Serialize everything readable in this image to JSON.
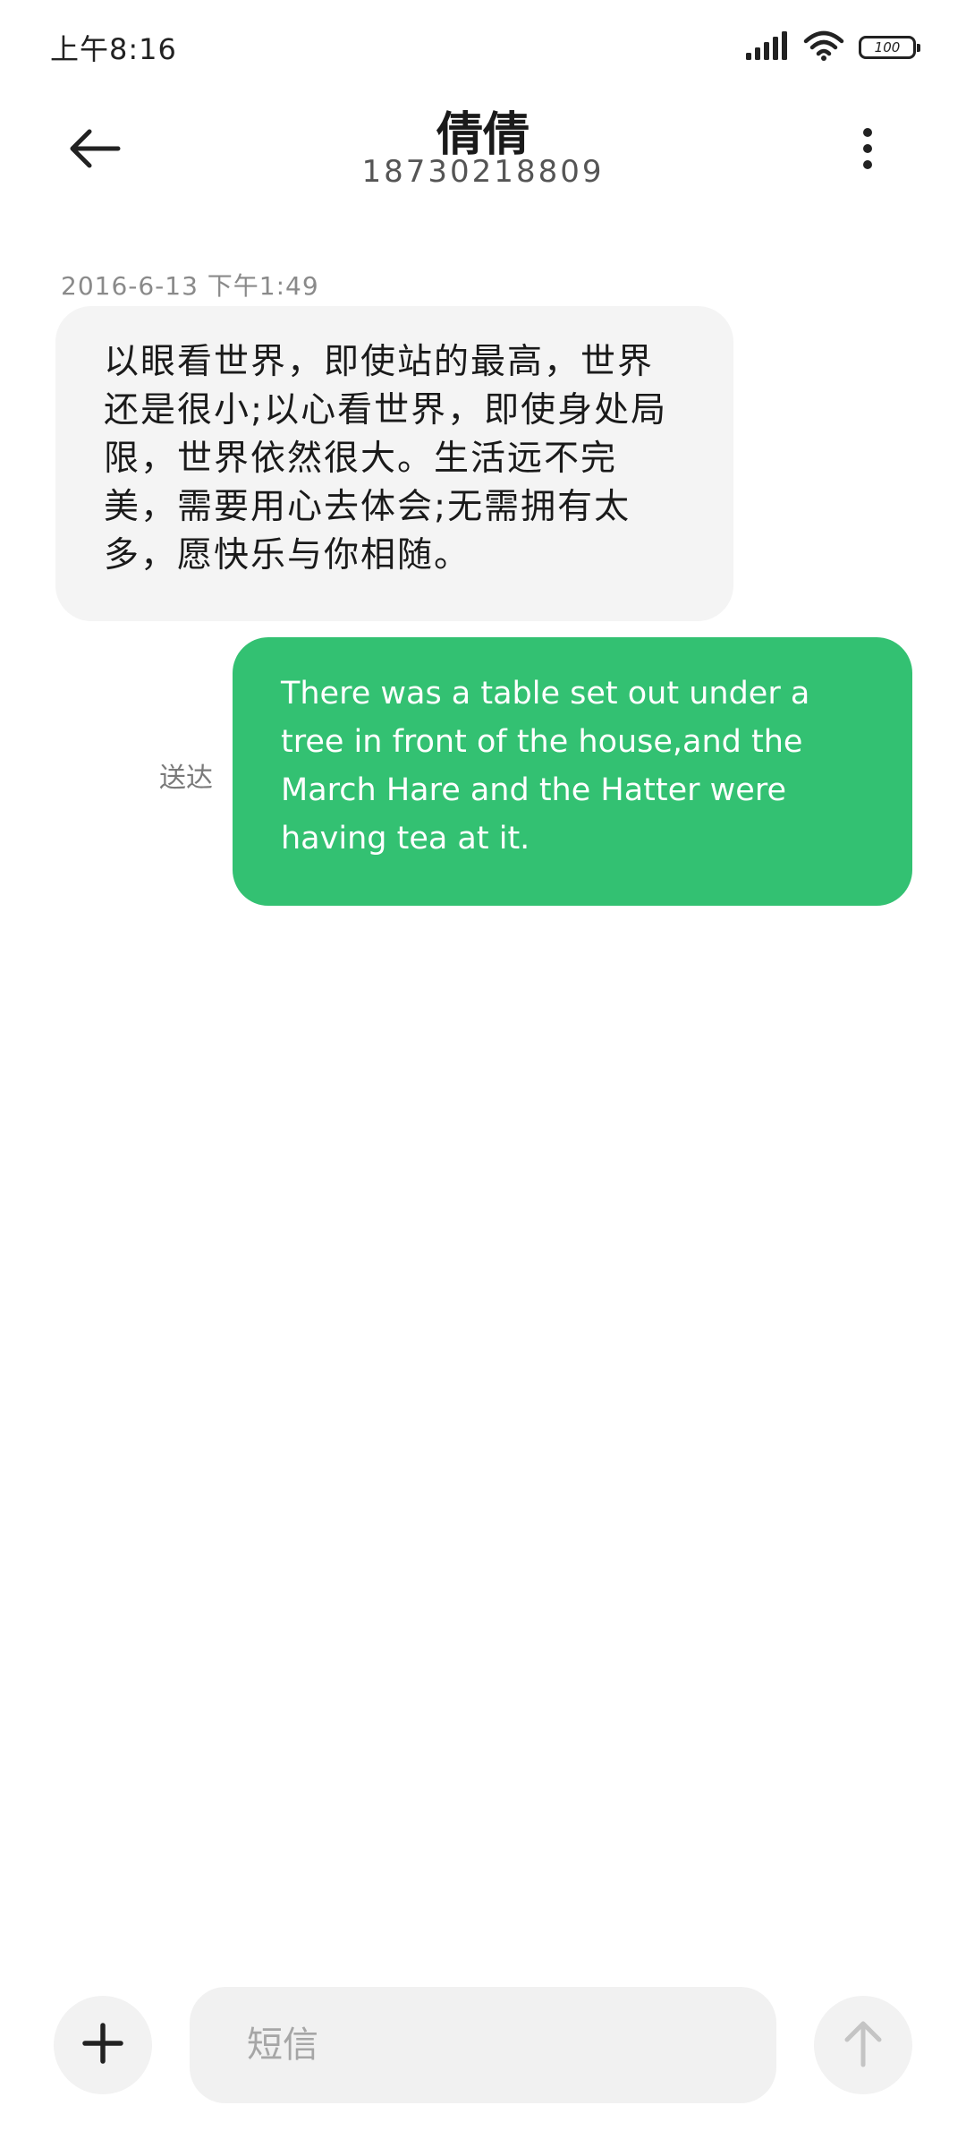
{
  "status_bar": {
    "time": "上午8:16",
    "battery_level": "100",
    "icons": [
      "signal-icon",
      "wifi-icon",
      "battery-icon"
    ]
  },
  "header": {
    "contact_name": "倩倩",
    "phone_number": "18730218809",
    "icons": [
      "back-arrow-icon",
      "more-vertical-icon"
    ]
  },
  "conversation": {
    "timestamp": "2016-6-13 下午1:49",
    "incoming_message": "以眼看世界，即使站的最高，世界还是很小;以心看世界，即使身处局限，世界依然很大。生活远不完美，需要用心去体会;无需拥有太多，愿快乐与你相随。",
    "outgoing_message": "There was a table set out under a tree in front of the house,and the March Hare and the Hatter were having tea at it.",
    "outgoing_status": "送达"
  },
  "composer": {
    "placeholder": "短信",
    "value": "",
    "icons": [
      "add-icon",
      "send-arrow-icon"
    ]
  },
  "colors": {
    "outgoing_bubble": "#33c172",
    "incoming_bubble": "#f4f4f4",
    "background": "#ffffff"
  }
}
